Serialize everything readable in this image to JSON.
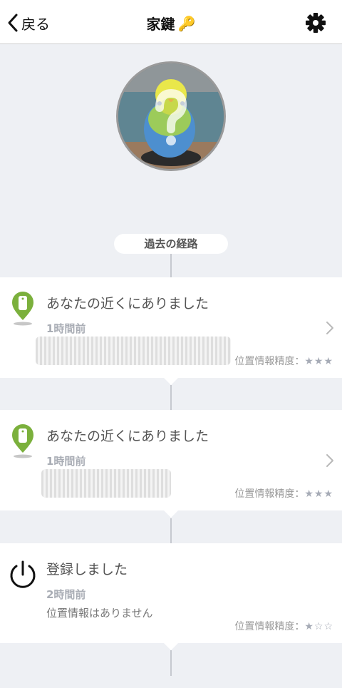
{
  "nav": {
    "back_label": "戻る",
    "title": "家鍵",
    "title_emoji": "🔑"
  },
  "history_label": "過去の経路",
  "cards": [
    {
      "title": "あなたの近くにありました",
      "time": "1時間前",
      "accuracy_label": "位置情報精度：",
      "stars": "★★★",
      "accuracy_level": 3
    },
    {
      "title": "あなたの近くにありました",
      "time": "1時間前",
      "accuracy_label": "位置情報精度：",
      "stars": "★★★",
      "accuracy_level": 3
    },
    {
      "title": "登録しました",
      "time": "2時間前",
      "note": "位置情報はありません",
      "accuracy_label": "位置情報精度：",
      "stars": "★☆☆",
      "accuracy_level": 1
    }
  ],
  "icons": {
    "back": "chevron-left-icon",
    "settings": "gear-icon",
    "location": "map-pin-icon",
    "power": "power-icon",
    "chevron": "chevron-right-icon",
    "unknown": "question-mark-icon"
  },
  "colors": {
    "pin_green": "#7bb03c",
    "background": "#eef0f4",
    "card": "#ffffff"
  }
}
